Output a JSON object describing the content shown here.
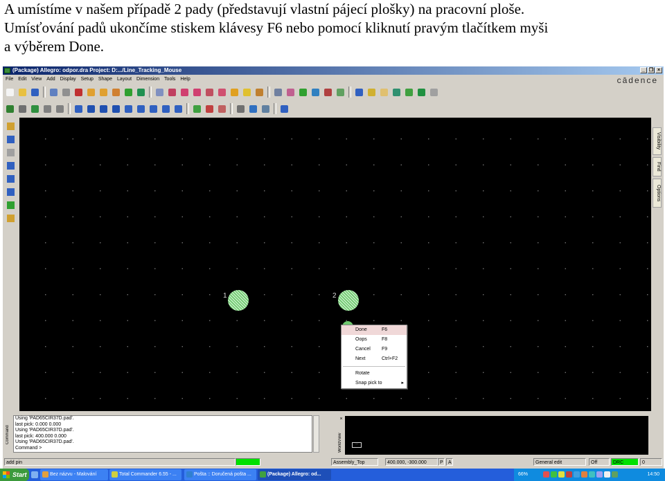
{
  "caption": {
    "line1": "A umístíme v našem případě 2 pady (představují vlastní pájecí plošky) na pracovní ploše.",
    "line2": "Umísťování padů ukončíme stiskem klávesy F6 nebo pomocí kliknutí pravým tlačítkem myši",
    "line3": "a výběrem Done."
  },
  "window": {
    "title": "(Package) Allegro: odpor.dra  Project: D:.../Line_Tracking_Mouse",
    "logo": "cādence",
    "buttons": [
      "_",
      "❐",
      "×"
    ]
  },
  "menu": [
    "File",
    "Edit",
    "View",
    "Add",
    "Display",
    "Setup",
    "Shape",
    "Layout",
    "Dimension",
    "Tools",
    "Help"
  ],
  "toolbar1": [
    {
      "name": "new-icon",
      "color": "#f4f4f4"
    },
    {
      "name": "open-icon",
      "color": "#e8c040"
    },
    {
      "name": "save-icon",
      "color": "#3060c0"
    },
    {
      "name": "move-icon",
      "color": "#6080c0"
    },
    {
      "name": "copy-icon",
      "color": "#909090"
    },
    {
      "name": "delete-icon",
      "color": "#c03030"
    },
    {
      "name": "undo-icon",
      "color": "#e0a030"
    },
    {
      "name": "redo-icon",
      "color": "#e0a030"
    },
    {
      "name": "rotate-icon",
      "color": "#d08030"
    },
    {
      "name": "pin-icon",
      "color": "#30a030"
    },
    {
      "name": "push-pin-icon",
      "color": "#209050"
    },
    {
      "name": "zoom-points-icon",
      "color": "#8090c0"
    },
    {
      "name": "zoom-fit-icon",
      "color": "#c04060"
    },
    {
      "name": "zoom-in-icon",
      "color": "#d04070"
    },
    {
      "name": "zoom-out-icon",
      "color": "#d04070"
    },
    {
      "name": "zoom-prev-icon",
      "color": "#c05060"
    },
    {
      "name": "zoom-world-icon",
      "color": "#d05070"
    },
    {
      "name": "redraw-icon",
      "color": "#e0a020"
    },
    {
      "name": "3d-view-icon",
      "color": "#e0c030"
    },
    {
      "name": "flat-view-icon",
      "color": "#c08030"
    },
    {
      "name": "grid-icon",
      "color": "#7080a0"
    },
    {
      "name": "color-icon",
      "color": "#c06090"
    },
    {
      "name": "shadow-icon",
      "color": "#30a030"
    },
    {
      "name": "layers-icon",
      "color": "#3080c0"
    },
    {
      "name": "highlight-icon",
      "color": "#b04040"
    },
    {
      "name": "dehighlight-icon",
      "color": "#60a060"
    },
    {
      "name": "info-icon",
      "color": "#3060c0"
    },
    {
      "name": "properties-icon",
      "color": "#d0b030"
    },
    {
      "name": "measure-icon",
      "color": "#e0c070"
    },
    {
      "name": "timer-icon",
      "color": "#309070"
    },
    {
      "name": "reports-icon",
      "color": "#40a040"
    },
    {
      "name": "f1-help-icon",
      "color": "#209040"
    },
    {
      "name": "db-icon",
      "color": "#a0a0a0"
    }
  ],
  "toolbar2": [
    {
      "name": "drc-icon",
      "color": "#308030"
    },
    {
      "name": "drc-off-icon",
      "color": "#707070"
    },
    {
      "name": "cross-icon",
      "color": "#309040"
    },
    {
      "name": "net-icon",
      "color": "#808080"
    },
    {
      "name": "sel-icon",
      "color": "#808080"
    },
    {
      "name": "pad-stack-icon",
      "color": "#3060c0"
    },
    {
      "name": "square-icon",
      "color": "#2050b0"
    },
    {
      "name": "circle-icon",
      "color": "#2050b0"
    },
    {
      "name": "shape-icon",
      "color": "#2050b0"
    },
    {
      "name": "rect-shape-icon",
      "color": "#3060c0"
    },
    {
      "name": "frame-icon",
      "color": "#3060c0"
    },
    {
      "name": "box-icon",
      "color": "#3060c0"
    },
    {
      "name": "box2-icon",
      "color": "#3060c0"
    },
    {
      "name": "edit-shape-icon",
      "color": "#3060c0"
    },
    {
      "name": "monitor-icon",
      "color": "#40a040"
    },
    {
      "name": "dim-icon",
      "color": "#c04040"
    },
    {
      "name": "dim2-icon",
      "color": "#c06060"
    },
    {
      "name": "camera-icon",
      "color": "#707070"
    },
    {
      "name": "windows-icon",
      "color": "#3070c0"
    },
    {
      "name": "script-icon",
      "color": "#6080a0"
    },
    {
      "name": "help-icon",
      "color": "#3060c0"
    }
  ],
  "lefttools": [
    {
      "name": "add-line-icon",
      "color": "#d0a030"
    },
    {
      "name": "add-text-icon",
      "color": "#3060c0"
    },
    {
      "name": "add-pin-icon",
      "color": "#a0a0a0"
    },
    {
      "name": "route-icon",
      "color": "#3060c0"
    },
    {
      "name": "draw-line-icon",
      "color": "#3060c0"
    },
    {
      "name": "rect-icon",
      "color": "#3060c0"
    },
    {
      "name": "add-via-icon",
      "color": "#30a030"
    },
    {
      "name": "edit-text-icon",
      "color": "#d0a030"
    }
  ],
  "pads": [
    {
      "label": "1"
    },
    {
      "label": "2"
    }
  ],
  "context_menu": [
    {
      "label": "Done",
      "shortcut": "F6",
      "selected": true
    },
    {
      "label": "Oops",
      "shortcut": "F8"
    },
    {
      "label": "Cancel",
      "shortcut": "F9"
    },
    {
      "label": "Next",
      "shortcut": "Ctrl+F2"
    },
    {
      "label": "Rotate",
      "shortcut": ""
    },
    {
      "label": "Snap pick to",
      "shortcut": "",
      "submenu": true
    }
  ],
  "right_tabs": [
    "Visibility",
    "Find",
    "Options"
  ],
  "command": {
    "label": "Command",
    "lines": [
      "Using 'PAD65CIR37D.pad'.",
      "last pick:  0.000  0.000",
      "Using 'PAD65CIR37D.pad'.",
      "last pick:  400.000  0.000",
      "Using 'PAD65CIR37D.pad'.",
      "Command >"
    ]
  },
  "worldview": {
    "label": "WorldView",
    "box_text": "··"
  },
  "status": {
    "mode": "add pin",
    "ready_color": "#00e000",
    "layer": "Assembly_Top",
    "coords": "400.000, -300.000",
    "p": "P",
    "a": "A",
    "edit_mode": "General edit",
    "off": "Off",
    "drc": "DRC",
    "drc_count": "0"
  },
  "taskbar": {
    "start": "Start",
    "items": [
      {
        "label": "Bez názvu - Malování",
        "color": "#e0a040"
      },
      {
        "label": "Total Commander 6.55 - ...",
        "color": "#d0d040"
      },
      {
        "label": "Pošta :: Doručená pošta ...",
        "color": "#3080d0"
      },
      {
        "label": "(Package) Allegro: od...",
        "color": "#40a040",
        "active": true
      }
    ],
    "volume": "66%",
    "clock": "14:50"
  }
}
